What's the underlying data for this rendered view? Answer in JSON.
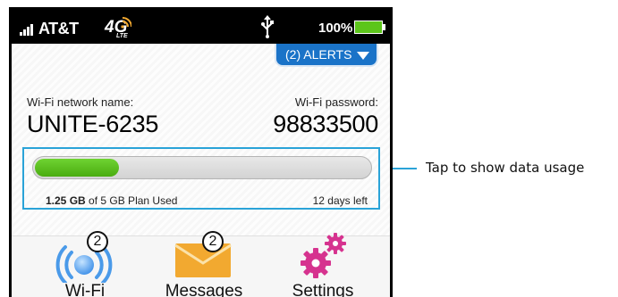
{
  "status_bar": {
    "carrier": "AT&T",
    "network_type": "4G",
    "network_subtype": "LTE",
    "battery_level": "100%",
    "signal_icon": "signal-bars-icon",
    "usb_icon": "usb-icon"
  },
  "alerts": {
    "label": "(2) ALERTS"
  },
  "wifi_info": {
    "name_label": "Wi-Fi network name:",
    "name_value": "UNITE-6235",
    "password_label": "Wi-Fi password:",
    "password_value": "98833500"
  },
  "data_usage": {
    "used_amount": "1.25 GB",
    "used_suffix": " of 5 GB Plan Used",
    "days_left": "12 days left",
    "fraction_used": 0.25
  },
  "tiles": [
    {
      "label": "Wi-Fi",
      "badge": "2",
      "icon": "wifi-icon"
    },
    {
      "label": "Messages",
      "badge": "2",
      "icon": "envelope-icon"
    },
    {
      "label": "Settings",
      "icon": "gears-icon"
    }
  ],
  "callout": {
    "text": "Tap to show data usage"
  },
  "colors": {
    "accent_blue": "#1a73c8",
    "highlight_blue": "#2aa3d8",
    "usage_green": "#5cc51a",
    "settings_magenta": "#d6338f",
    "envelope_orange": "#f2a930"
  }
}
